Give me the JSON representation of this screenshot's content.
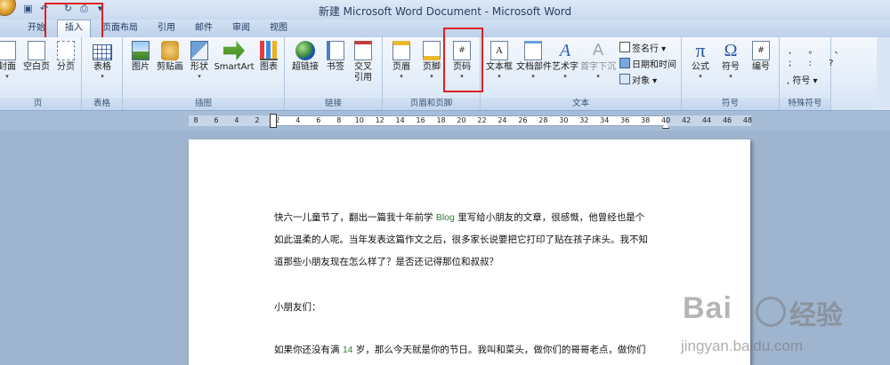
{
  "window": {
    "title": "新建 Microsoft Word Document - Microsoft Word"
  },
  "tabs": [
    {
      "label": "开始"
    },
    {
      "label": "插入"
    },
    {
      "label": "页面布局"
    },
    {
      "label": "引用"
    },
    {
      "label": "邮件"
    },
    {
      "label": "审阅"
    },
    {
      "label": "视图"
    }
  ],
  "ribbon": {
    "groups": {
      "pages": "页",
      "tables": "表格",
      "illustrations": "插图",
      "links": "链接",
      "header_footer": "页眉和页脚",
      "text": "文本",
      "symbols": "符号",
      "special_symbols": "特殊符号"
    },
    "buttons": {
      "cover": "封面",
      "blank_page": "空白页",
      "page_break": "分页",
      "table": "表格",
      "picture": "图片",
      "clip_art": "剪贴画",
      "shapes": "形状",
      "smartart": "SmartArt",
      "chart": "图表",
      "hyperlink": "超链接",
      "bookmark": "书签",
      "cross_ref_1": "交叉",
      "cross_ref_2": "引用",
      "header": "页眉",
      "footer": "页脚",
      "page_number": "页码",
      "text_box": "文本框",
      "quick_parts": "文档部件",
      "wordart": "艺术字",
      "drop_cap": "首字下沉",
      "signature_line": "签名行",
      "date_time": "日期和时间",
      "object": "对象",
      "equation": "公式",
      "symbol": "符号",
      "number": "编号",
      "special_symbol": "符号"
    }
  },
  "ruler": {
    "ticks": [
      "8",
      "6",
      "4",
      "2",
      "2",
      "4",
      "6",
      "8",
      "10",
      "12",
      "14",
      "16",
      "18",
      "20",
      "22",
      "24",
      "26",
      "28",
      "30",
      "32",
      "34",
      "36",
      "38",
      "40",
      "42",
      "44",
      "46",
      "48"
    ]
  },
  "document": {
    "p1_l1a": "快六一儿童节了，翻出一篇我十年前学 ",
    "p1_l1b": "Blog",
    "p1_l1c": " 里写给小朋友的文章，很感慨，他曾经也是个",
    "p1_l2": "如此温柔的人呢。当年发表这篇作文之后，很多家长说要把它打印了贴在孩子床头。我不知",
    "p1_l3": "道那些小朋友现在怎么样了？是否还记得那位和叔叔？",
    "p2": "小朋友们：",
    "p3a": "如果你还没有满 ",
    "p3b": "14",
    "p3c": " 岁，那么今天就是你的节日。我叫和菜头，做你们的哥哥老点，做你们"
  },
  "watermark": {
    "brand": "Bai",
    "brand_cn": "经验",
    "url": "jingyan.baidu.com"
  },
  "colors": {
    "highlight_box": "#e02020",
    "ribbon_bg": "#e5eef9",
    "doc_bg": "#9fb4cf"
  }
}
